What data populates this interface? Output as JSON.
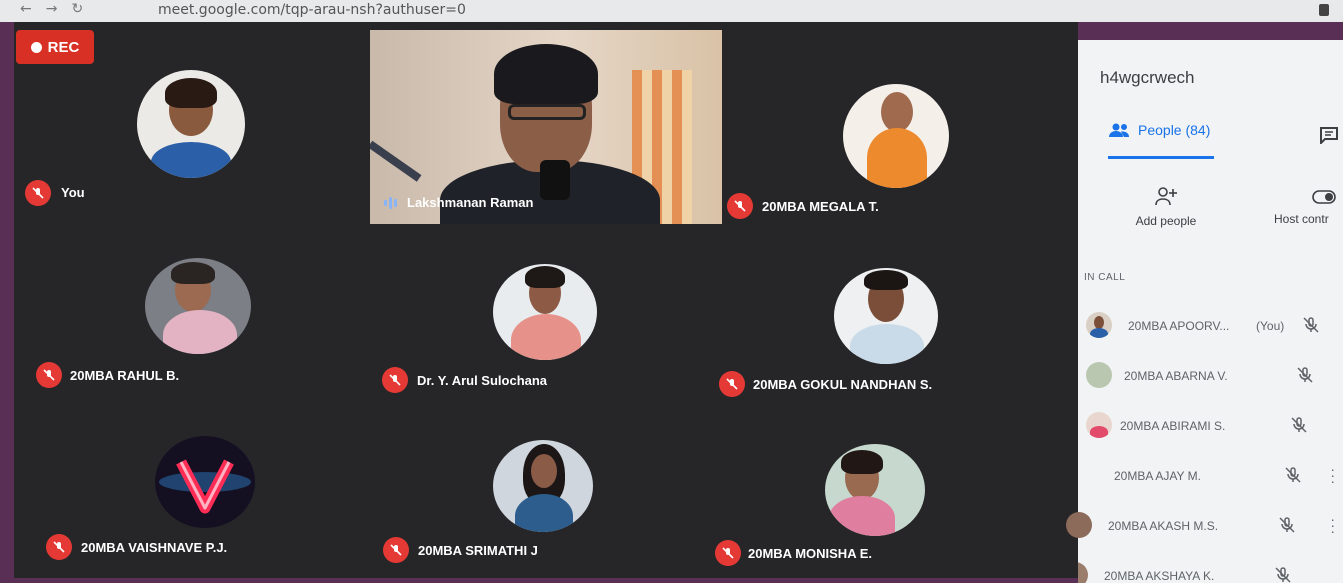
{
  "browser": {
    "url": "meet.google.com/tqp-arau-nsh?authuser=0"
  },
  "rec_label": "REC",
  "tiles": {
    "you": "You",
    "presenter": "Lakshmanan Raman",
    "megala": "20MBA MEGALA T.",
    "rahul": "20MBA RAHUL B.",
    "arul": "Dr. Y. Arul Sulochana",
    "gokul": "20MBA GOKUL NANDHAN S.",
    "vaishnave": "20MBA VAISHNAVE P.J.",
    "srimathi": "20MBA SRIMATHI J",
    "monisha": "20MBA MONISHA E."
  },
  "panel": {
    "meeting_code": "h4wgcrwech",
    "people_tab": "People (84)",
    "add_people": "Add people",
    "host_controls": "Host contr",
    "in_call": "IN CALL",
    "participants": [
      {
        "name": "20MBA APOORV...",
        "you": "(You)"
      },
      {
        "name": "20MBA ABARNA V."
      },
      {
        "name": "20MBA ABIRAMI S."
      },
      {
        "name": "20MBA AJAY M."
      },
      {
        "name": "20MBA AKASH M.S."
      },
      {
        "name": "20MBA AKSHAYA K."
      }
    ]
  },
  "colors": {
    "stage": "#262629",
    "mute": "#e53935",
    "accent": "#1a73e8",
    "rec": "#d93025"
  },
  "icons": [
    "record-dot-icon",
    "mic-off-icon",
    "audio-bars-icon",
    "people-icon",
    "chat-icon",
    "add-person-icon",
    "toggle-icon",
    "more-vert-icon"
  ]
}
